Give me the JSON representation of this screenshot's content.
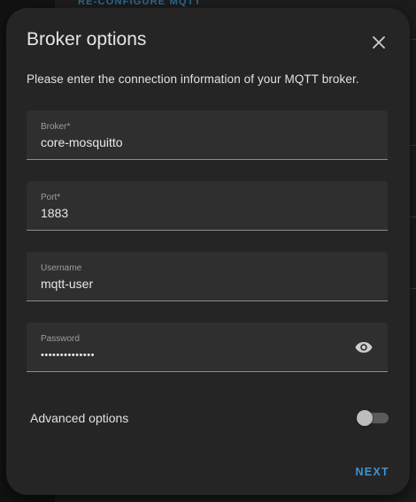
{
  "background": {
    "link_text": "RE-CONFIGURE MQTT"
  },
  "dialog": {
    "title": "Broker options",
    "close_icon": "close-icon",
    "description": "Please enter the connection information of your MQTT broker.",
    "fields": {
      "broker": {
        "label": "Broker*",
        "value": "core-mosquitto"
      },
      "port": {
        "label": "Port*",
        "value": "1883"
      },
      "username": {
        "label": "Username",
        "value": "mqtt-user"
      },
      "password": {
        "label": "Password",
        "value": "••••••••••••••",
        "icon": "eye-icon"
      }
    },
    "advanced": {
      "label": "Advanced options",
      "enabled": false
    },
    "next_label": "NEXT"
  },
  "colors": {
    "accent": "#3a94d6",
    "surface": "#252525",
    "field_bg": "#2f2f2f"
  }
}
